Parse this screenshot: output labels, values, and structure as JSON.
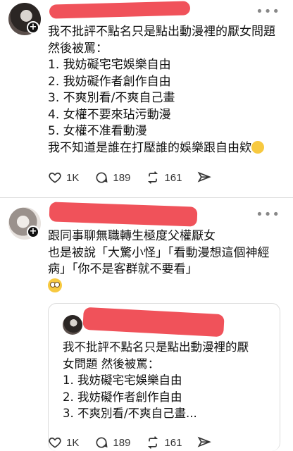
{
  "post1": {
    "lines": [
      "我不批評不點名只是點出動漫裡的厭女問題",
      "然後被罵：",
      "1. 我妨礙宅宅娛樂自由",
      "2. 我妨礙作者創作自由",
      "3. 不爽別看/不爽自己畫",
      "4. 女權不要來玷污動漫",
      "5. 女權不准看動漫",
      "我不知道是誰在打壓誰的娛樂跟自由欸"
    ],
    "emoji": "thinking-face",
    "likes": "1K",
    "replies": "189",
    "reposts": "161"
  },
  "post2": {
    "lines": [
      "跟同事聊無職轉生極度父權厭女",
      "也是被說「大驚小怪」「看動漫想這個神經",
      "病」「你不是客群就不要看」"
    ],
    "emoji": "face-with-rolling-eyes",
    "quote": {
      "lines": [
        "我不批評不點名只是點出動漫裡的厭",
        "女問題 然後被罵：",
        "1. 我妨礙宅宅娛樂自由",
        "2. 我妨礙作者創作自由",
        "3. 不爽別看/不爽自己畫..."
      ]
    },
    "likes": "1K",
    "replies": "189",
    "reposts": "161"
  },
  "colors": {
    "redaction": "#f0525a",
    "text": "#111111",
    "icon": "#333333"
  }
}
